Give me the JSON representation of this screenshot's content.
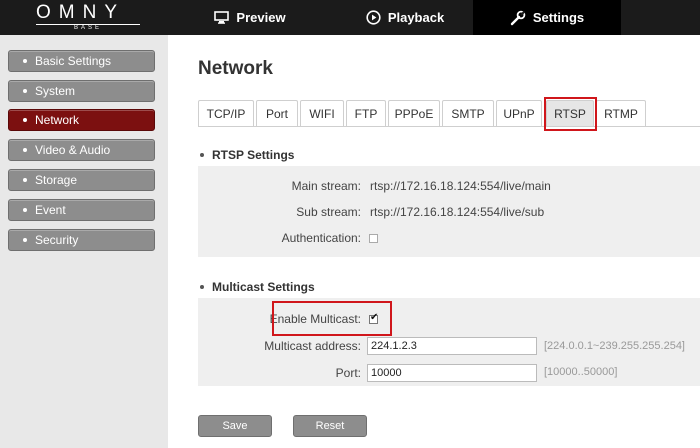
{
  "brand": {
    "name": "OMNY",
    "sub": "BASE"
  },
  "nav": [
    {
      "label": "Preview",
      "icon": "monitor-icon"
    },
    {
      "label": "Playback",
      "icon": "play-circle-icon"
    },
    {
      "label": "Settings",
      "icon": "wrench-icon",
      "active": true
    }
  ],
  "sidebar": {
    "items": [
      {
        "label": "Basic Settings"
      },
      {
        "label": "System"
      },
      {
        "label": "Network",
        "active": true
      },
      {
        "label": "Video & Audio"
      },
      {
        "label": "Storage"
      },
      {
        "label": "Event"
      },
      {
        "label": "Security"
      }
    ]
  },
  "page": {
    "title": "Network"
  },
  "tabs": [
    {
      "label": "TCP/IP"
    },
    {
      "label": "Port"
    },
    {
      "label": "WIFI"
    },
    {
      "label": "FTP"
    },
    {
      "label": "PPPoE"
    },
    {
      "label": "SMTP"
    },
    {
      "label": "UPnP"
    },
    {
      "label": "RTSP",
      "active": true
    },
    {
      "label": "RTMP"
    }
  ],
  "rtsp": {
    "heading": "RTSP Settings",
    "main_stream_label": "Main stream:",
    "main_stream_value": "rtsp://172.16.18.124:554/live/main",
    "sub_stream_label": "Sub stream:",
    "sub_stream_value": "rtsp://172.16.18.124:554/live/sub",
    "auth_label": "Authentication:",
    "auth_checked": false
  },
  "multicast": {
    "heading": "Multicast Settings",
    "enable_label": "Enable Multicast:",
    "enable_checked": true,
    "address_label": "Multicast address:",
    "address_value": "224.1.2.3",
    "address_hint": "[224.0.0.1~239.255.255.254]",
    "port_label": "Port:",
    "port_value": "10000",
    "port_hint": "[10000..50000]"
  },
  "buttons": {
    "save": "Save",
    "reset": "Reset"
  },
  "colors": {
    "active_sidebar": "#7c1010",
    "highlight": "#d0161b",
    "topbar": "#1b1b1b"
  }
}
